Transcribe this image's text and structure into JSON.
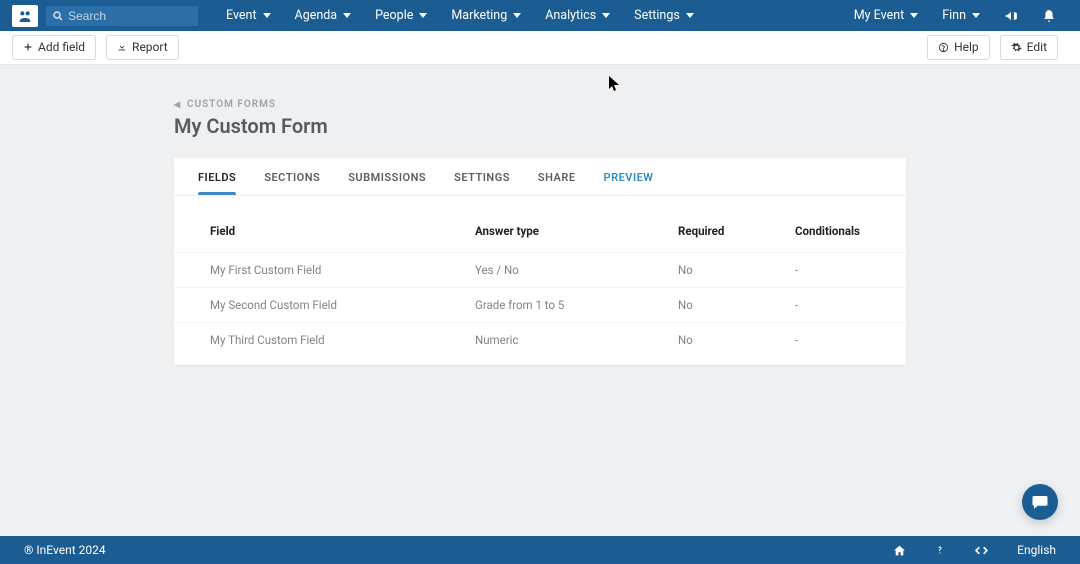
{
  "search": {
    "placeholder": "Search"
  },
  "nav": {
    "items": [
      {
        "label": "Event"
      },
      {
        "label": "Agenda"
      },
      {
        "label": "People"
      },
      {
        "label": "Marketing"
      },
      {
        "label": "Analytics"
      },
      {
        "label": "Settings"
      }
    ],
    "myEvent": "My Event",
    "user": "Finn"
  },
  "actions": {
    "addField": "Add field",
    "report": "Report",
    "help": "Help",
    "edit": "Edit"
  },
  "breadcrumb": {
    "label": "CUSTOM FORMS"
  },
  "page": {
    "title": "My Custom Form"
  },
  "tabs": [
    {
      "label": "FIELDS"
    },
    {
      "label": "SECTIONS"
    },
    {
      "label": "SUBMISSIONS"
    },
    {
      "label": "SETTINGS"
    },
    {
      "label": "SHARE"
    },
    {
      "label": "PREVIEW"
    }
  ],
  "table": {
    "headers": {
      "field": "Field",
      "answerType": "Answer type",
      "required": "Required",
      "conditionals": "Conditionals"
    },
    "rows": [
      {
        "field": "My First Custom Field",
        "answerType": "Yes / No",
        "required": "No",
        "conditionals": "-"
      },
      {
        "field": "My Second Custom Field",
        "answerType": "Grade from 1 to 5",
        "required": "No",
        "conditionals": "-"
      },
      {
        "field": "My Third Custom Field",
        "answerType": "Numeric",
        "required": "No",
        "conditionals": "-"
      }
    ]
  },
  "footer": {
    "copyright": "® InEvent 2024",
    "language": "English"
  }
}
